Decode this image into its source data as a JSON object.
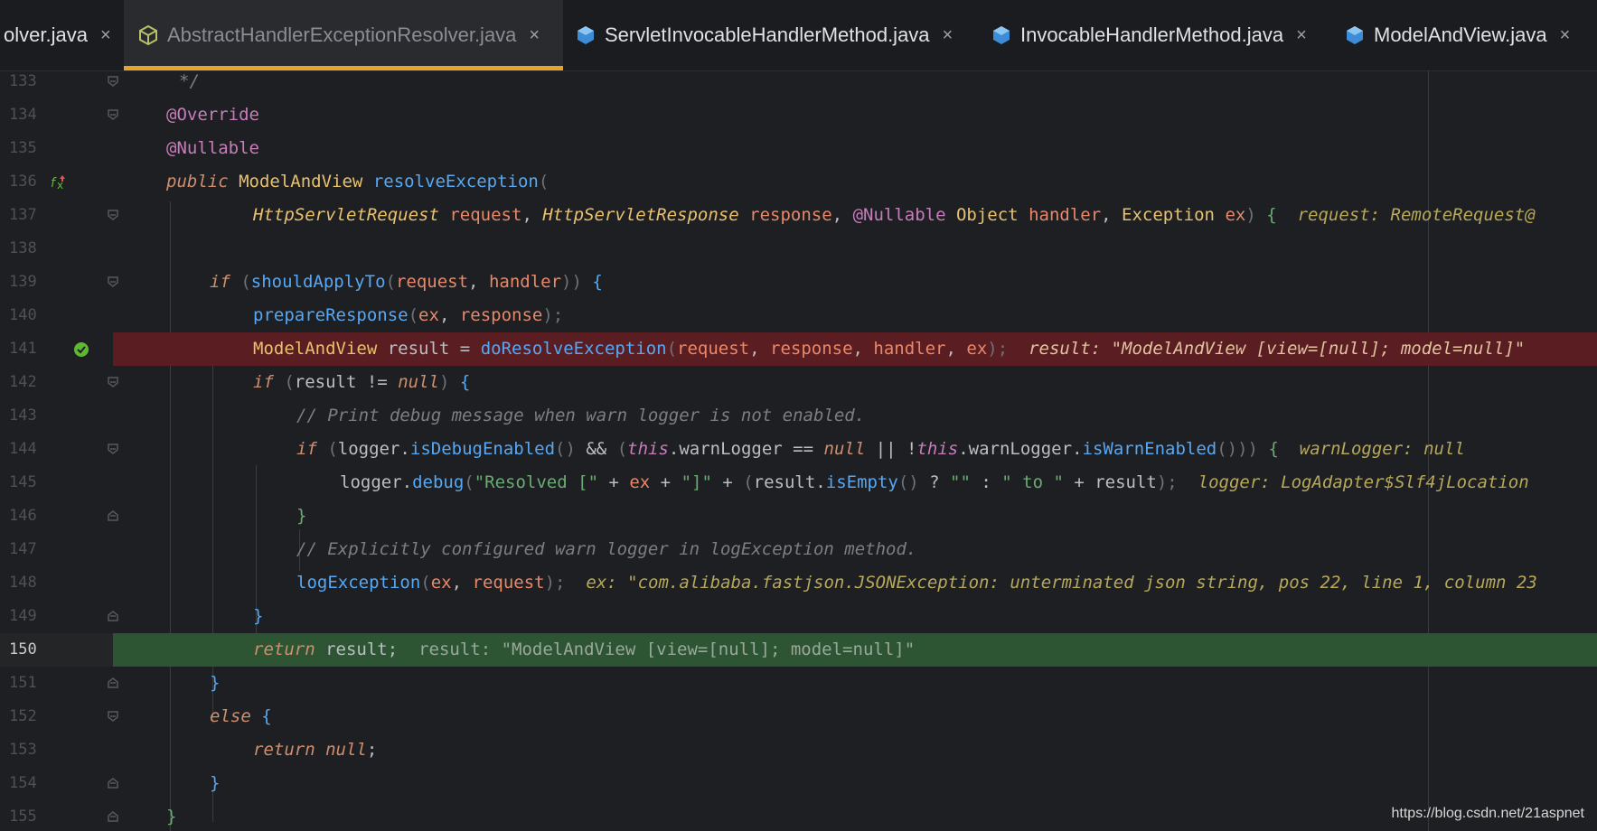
{
  "tabs": [
    {
      "label": "olver.java",
      "active": false,
      "icon": "none"
    },
    {
      "label": "AbstractHandlerExceptionResolver.java",
      "active": true,
      "icon": "abstract-class-icon"
    },
    {
      "label": "ServletInvocableHandlerMethod.java",
      "active": false,
      "icon": "class-icon"
    },
    {
      "label": "InvocableHandlerMethod.java",
      "active": false,
      "icon": "class-icon"
    },
    {
      "label": "ModelAndView.java",
      "active": false,
      "icon": "class-icon"
    }
  ],
  "close_glyph": "×",
  "line_numbers": [
    "133",
    "134",
    "135",
    "136",
    "137",
    "138",
    "139",
    "140",
    "141",
    "142",
    "143",
    "144",
    "145",
    "146",
    "147",
    "148",
    "149",
    "150",
    "151",
    "152",
    "153",
    "154",
    "155"
  ],
  "code": {
    "l133": "*/",
    "l134": "@Override",
    "l135": "@Nullable",
    "l136": {
      "t1": "public",
      "t2": "ModelAndView",
      "t3": "resolveException",
      "t4": "("
    },
    "l137": {
      "t1": "HttpServletRequest",
      "t2": "request",
      "t3": ",",
      "t4": "HttpServletResponse",
      "t5": "response",
      "t6": ",",
      "t7": "@Nullable",
      "t8": "Object",
      "t9": "handler",
      "t10": ",",
      "t11": "Exception",
      "t12": "ex",
      "t13": ")",
      "t14": "{",
      "hint": "request: RemoteRequest@"
    },
    "l139": {
      "t1": "if",
      "t2": "(",
      "t3": "shouldApplyTo",
      "t4": "(",
      "t5": "request",
      "t6": ", ",
      "t7": "handler",
      "t8": "))",
      "t9": "{"
    },
    "l140": {
      "t1": "prepareResponse",
      "t2": "(",
      "t3": "ex",
      "t4": ", ",
      "t5": "response",
      "t6": ");"
    },
    "l141": {
      "t1": "ModelAndView",
      "t2": "result = ",
      "t3": "doResolveException",
      "t4": "(",
      "t5": "request",
      "t6": ", ",
      "t7": "response",
      "t8": ", ",
      "t9": "handler",
      "t10": ", ",
      "t11": "ex",
      "t12": ");",
      "hint": "result: \"ModelAndView [view=[null]; model=null]\""
    },
    "l142": {
      "t1": "if",
      "t2": "(",
      "t3": "result != ",
      "t4": "null",
      "t5": ")",
      "t6": "{"
    },
    "l143": "// Print debug message when warn logger is not enabled.",
    "l144": {
      "t1": "if",
      "t2": "(",
      "t3": "logger.",
      "t4": "isDebugEnabled",
      "t5": "()",
      "t6": " && ",
      "t7": "(",
      "t8": "this",
      "t9": ".warnLogger == ",
      "t10": "null",
      "t11": " || !",
      "t12": "this",
      "t13": ".warnLogger.",
      "t14": "isWarnEnabled",
      "t15": "()))",
      "t16": "{",
      "hint": "warnLogger: null"
    },
    "l145": {
      "t1": "logger.",
      "t2": "debug",
      "t3": "(",
      "t4": "\"Resolved [\"",
      "t5": " + ",
      "t6": "ex",
      "t7": " + ",
      "t8": "\"]\"",
      "t9": " + ",
      "t10": "(",
      "t11": "result.",
      "t12": "isEmpty",
      "t13": "()",
      "t14": " ? ",
      "t15": "\"\"",
      "t16": " : ",
      "t17": "\" to \"",
      "t18": " + result",
      "t19": ");",
      "hint": "logger: LogAdapter$Slf4jLocation"
    },
    "l146": "}",
    "l147": "// Explicitly configured warn logger in logException method.",
    "l148": {
      "t1": "logException",
      "t2": "(",
      "t3": "ex",
      "t4": ", ",
      "t5": "request",
      "t6": ");",
      "hint": "ex: \"com.alibaba.fastjson.JSONException: unterminated json string, pos 22, line 1, column 23"
    },
    "l149": "}",
    "l150": {
      "t1": "return",
      "t2": "result;",
      "hint": "result: \"ModelAndView [view=[null]; model=null]\""
    },
    "l151": "}",
    "l152": {
      "t1": "else",
      "t2": "{"
    },
    "l153": {
      "t1": "return",
      "t2": "null",
      "t3": ";"
    },
    "l154": "}",
    "l155": "}"
  },
  "gutter_icons": {
    "override": "override-marker-icon",
    "breakpoint": "breakpoint-checked-icon",
    "fold": "fold-marker-icon"
  },
  "colors": {
    "background": "#1e1f22",
    "breakpoint_line": "#5a1d22",
    "execution_line": "#2d5534",
    "active_tab_underline": "#e7a32b"
  },
  "watermark": "https://blog.csdn.net/21aspnet"
}
